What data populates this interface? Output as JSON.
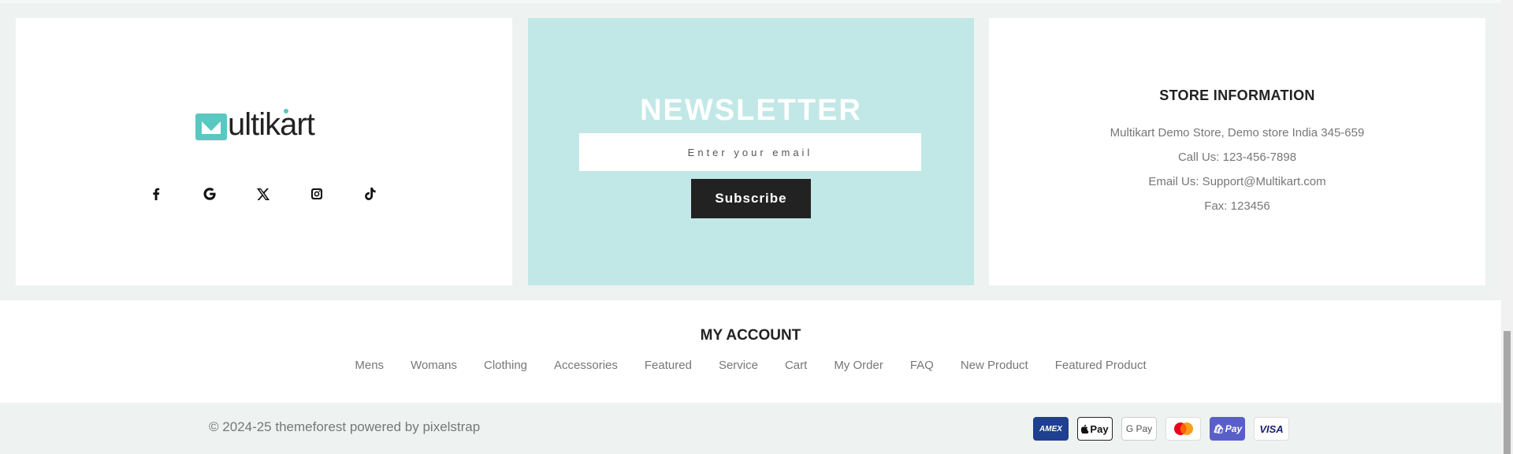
{
  "brand": {
    "logo_text": "ultikart",
    "logo_letter": "M"
  },
  "socials": [
    {
      "icon": "facebook-icon",
      "glyph": "f"
    },
    {
      "icon": "google-icon",
      "glyph": "G"
    },
    {
      "icon": "x-twitter-icon",
      "glyph": "X"
    },
    {
      "icon": "instagram-icon",
      "glyph": "◙"
    },
    {
      "icon": "tiktok-icon",
      "glyph": "♪"
    }
  ],
  "newsletter": {
    "title": "NEWSLETTER",
    "placeholder": "Enter your email",
    "subscribe_label": "Subscribe"
  },
  "store": {
    "title": "STORE INFORMATION",
    "address": "Multikart Demo Store, Demo store India 345-659",
    "phone": "Call Us: 123-456-7898",
    "email": "Email Us: Support@Multikart.com",
    "fax": "Fax: 123456"
  },
  "account": {
    "title": "MY ACCOUNT",
    "links": [
      "Mens",
      "Womans",
      "Clothing",
      "Accessories",
      "Featured",
      "Service",
      "Cart",
      "My Order",
      "FAQ",
      "New Product",
      "Featured Product"
    ]
  },
  "footer": {
    "copyright": "© 2024-25 themeforest powered by pixelstrap",
    "payments": [
      {
        "icon": "amex-icon",
        "label": "AMEX"
      },
      {
        "icon": "apple-pay-icon",
        "label": " Pay"
      },
      {
        "icon": "google-pay-icon",
        "label": "G Pay"
      },
      {
        "icon": "mastercard-icon",
        "label": ""
      },
      {
        "icon": "shop-pay-icon",
        "label": "Pay"
      },
      {
        "icon": "visa-icon",
        "label": "VISA"
      }
    ]
  },
  "colors": {
    "accent": "#5ac8c0",
    "newsletter_bg": "#c1e8e6",
    "dark": "#222222"
  }
}
